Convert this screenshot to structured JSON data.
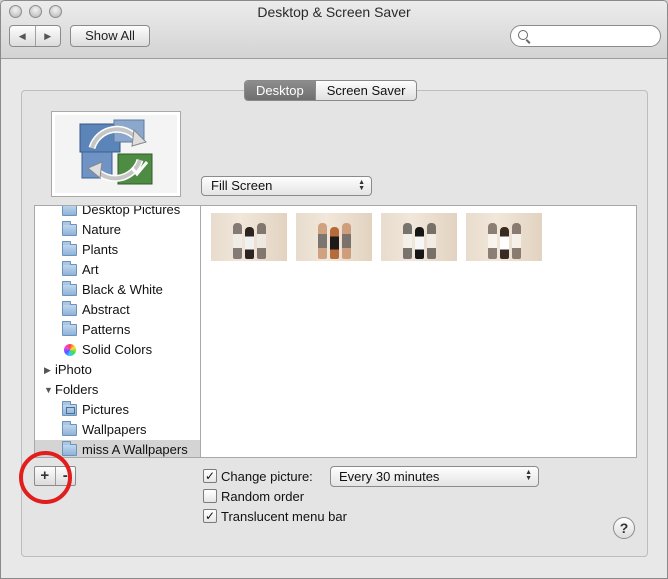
{
  "window": {
    "title": "Desktop & Screen Saver"
  },
  "toolbar": {
    "back_glyph": "◀",
    "forward_glyph": "▶",
    "show_all_label": "Show All",
    "search_placeholder": ""
  },
  "tabs": [
    {
      "label": "Desktop",
      "active": true
    },
    {
      "label": "Screen Saver",
      "active": false
    }
  ],
  "fill_mode": {
    "selected": "Fill Screen"
  },
  "sources": {
    "items": [
      {
        "label": "Desktop Pictures",
        "icon": "folder-icon",
        "indent": 1
      },
      {
        "label": "Nature",
        "icon": "folder-icon",
        "indent": 1
      },
      {
        "label": "Plants",
        "icon": "folder-icon",
        "indent": 1
      },
      {
        "label": "Art",
        "icon": "folder-icon",
        "indent": 1
      },
      {
        "label": "Black & White",
        "icon": "folder-icon",
        "indent": 1
      },
      {
        "label": "Abstract",
        "icon": "folder-icon",
        "indent": 1
      },
      {
        "label": "Patterns",
        "icon": "folder-icon",
        "indent": 1
      },
      {
        "label": "Solid Colors",
        "icon": "color-wheel-icon",
        "indent": 1
      },
      {
        "label": "iPhoto",
        "icon": "disclosure-collapsed-icon",
        "indent": 0
      },
      {
        "label": "Folders",
        "icon": "disclosure-expanded-icon",
        "indent": 0
      },
      {
        "label": "Pictures",
        "icon": "pictures-folder-icon",
        "indent": 1
      },
      {
        "label": "Wallpapers",
        "icon": "folder-icon",
        "indent": 1
      },
      {
        "label": "miss A Wallpapers",
        "icon": "folder-icon",
        "indent": 1,
        "selected": true
      }
    ]
  },
  "thumbnails": [
    {
      "name": "wallpaper-1"
    },
    {
      "name": "wallpaper-2"
    },
    {
      "name": "wallpaper-3"
    },
    {
      "name": "wallpaper-4"
    }
  ],
  "controls": {
    "add_label": "+",
    "remove_label": "-",
    "change_picture_label": "Change picture:",
    "change_picture_checked": true,
    "interval": "Every 30 minutes",
    "random_order_label": "Random order",
    "random_order_checked": false,
    "translucent_menu_label": "Translucent menu bar",
    "translucent_menu_checked": true,
    "check_glyph": "✓",
    "help_label": "?"
  },
  "colors": {
    "highlight_circle": "#e11d1d",
    "active_tab": "#7c7c7c",
    "selected_row": "#d4d4d4"
  }
}
